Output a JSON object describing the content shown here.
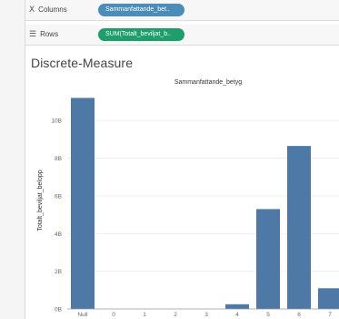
{
  "shelves": {
    "columns": {
      "label": "Columns",
      "icon": "columns-icon",
      "pill": "Sammanfattande_bet..",
      "pill_color": "#4b8db8"
    },
    "rows": {
      "label": "Rows",
      "icon": "rows-icon",
      "pill": "SUM(Totalt_beviljat_b..",
      "pill_color": "#1e9e6b"
    }
  },
  "worksheet": {
    "title": "Discrete-Measure"
  },
  "chart_data": {
    "type": "bar",
    "title": "Sammanfattande_betyg",
    "xlabel": "",
    "ylabel": "Totalt_beviljat_belopp",
    "categories": [
      "Null",
      "0",
      "1",
      "2",
      "3",
      "4",
      "5",
      "6",
      "7"
    ],
    "values": [
      11.2,
      0,
      0,
      0,
      0,
      0.25,
      5.3,
      8.65,
      1.1
    ],
    "yticks": [
      0,
      2,
      4,
      6,
      8,
      10
    ],
    "ytick_labels": [
      "0B",
      "2B",
      "4B",
      "6B",
      "8B",
      "10B"
    ],
    "ylim": [
      0,
      11.8
    ],
    "bar_color": "#4e79a7",
    "grid": true
  }
}
